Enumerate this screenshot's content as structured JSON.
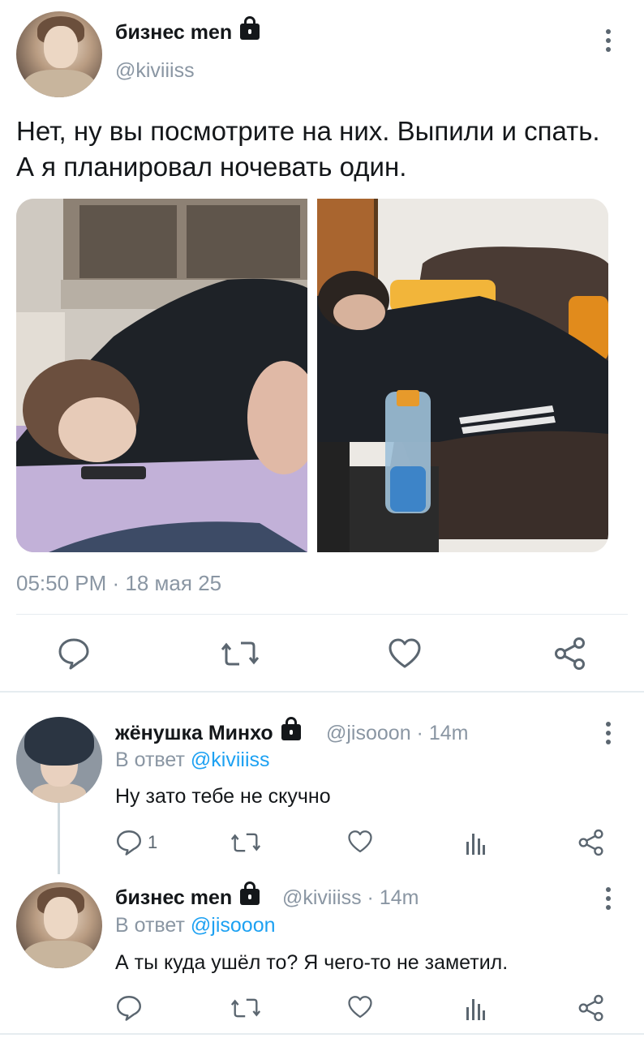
{
  "main_tweet": {
    "author_name": "бизнес men",
    "handle": "@kiviiiss",
    "text": "Нет, ну вы посмотрите на них. Выпили и спать. А я планировал ночевать один.",
    "time": "05:50 PM",
    "separator": " · ",
    "date": "18 мая 25",
    "images": [
      {
        "icon": "photo-person-sleeping-on-floor"
      },
      {
        "icon": "photo-person-sleeping-on-sofa"
      }
    ],
    "actions": [
      "reply-icon",
      "retweet-icon",
      "like-icon",
      "share-icon"
    ]
  },
  "replies": [
    {
      "author_name": "жёнушка Минхо",
      "handle": "@jisooon",
      "time": "14m",
      "reply_prefix": "В ответ ",
      "reply_to": "@kiviiiss",
      "text": "Ну зато тебе не скучно",
      "reply_count": "1"
    },
    {
      "author_name": "бизнес men",
      "handle": "@kiviiiss",
      "time": "14m",
      "reply_prefix": "В ответ ",
      "reply_to": "@jisooon",
      "text": "А ты куда ушёл то? Я чего-то не заметил.",
      "reply_count": ""
    }
  ],
  "colors": {
    "text": "#14171a",
    "secondary": "#8a96a3",
    "icon": "#5b6670",
    "link": "#1da1f2",
    "divider": "#e6ecf0"
  }
}
